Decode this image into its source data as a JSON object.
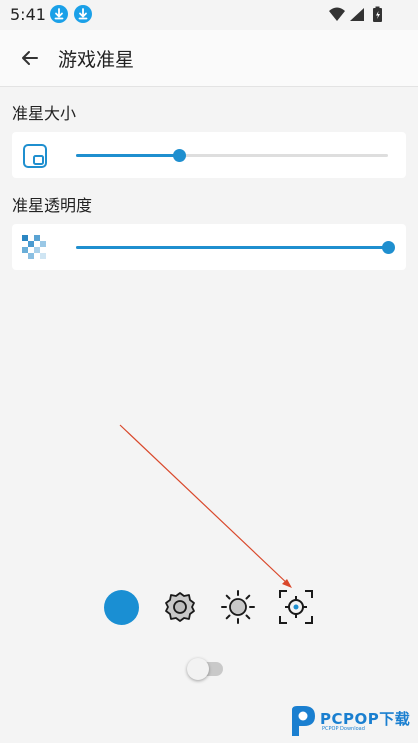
{
  "status_bar": {
    "time": "5:41",
    "icons": [
      "download-icon",
      "download-icon",
      "wifi-icon",
      "cell-signal-icon",
      "battery-icon"
    ]
  },
  "app_bar": {
    "title": "游戏准星",
    "back_icon": "back-arrow-icon"
  },
  "crosshair_size": {
    "label": "准星大小",
    "icon": "size-icon",
    "value_fraction": 0.33
  },
  "crosshair_opacity": {
    "label": "准星透明度",
    "icon": "transparency-icon",
    "value_fraction": 1.0
  },
  "bottom_buttons": [
    {
      "name": "color-button",
      "icon": "blue-circle"
    },
    {
      "name": "settings-button",
      "icon": "gear-icon"
    },
    {
      "name": "brightness-button",
      "icon": "sun-icon"
    },
    {
      "name": "crosshair-button",
      "icon": "crosshair-icon"
    }
  ],
  "toggle": {
    "on": false
  },
  "watermark": {
    "brand": "PCPOP下载",
    "sub": "PCPOP Download"
  },
  "colors": {
    "accent": "#1f8fcf",
    "annotation_arrow": "#d9482b",
    "background": "#f4f4f4"
  }
}
